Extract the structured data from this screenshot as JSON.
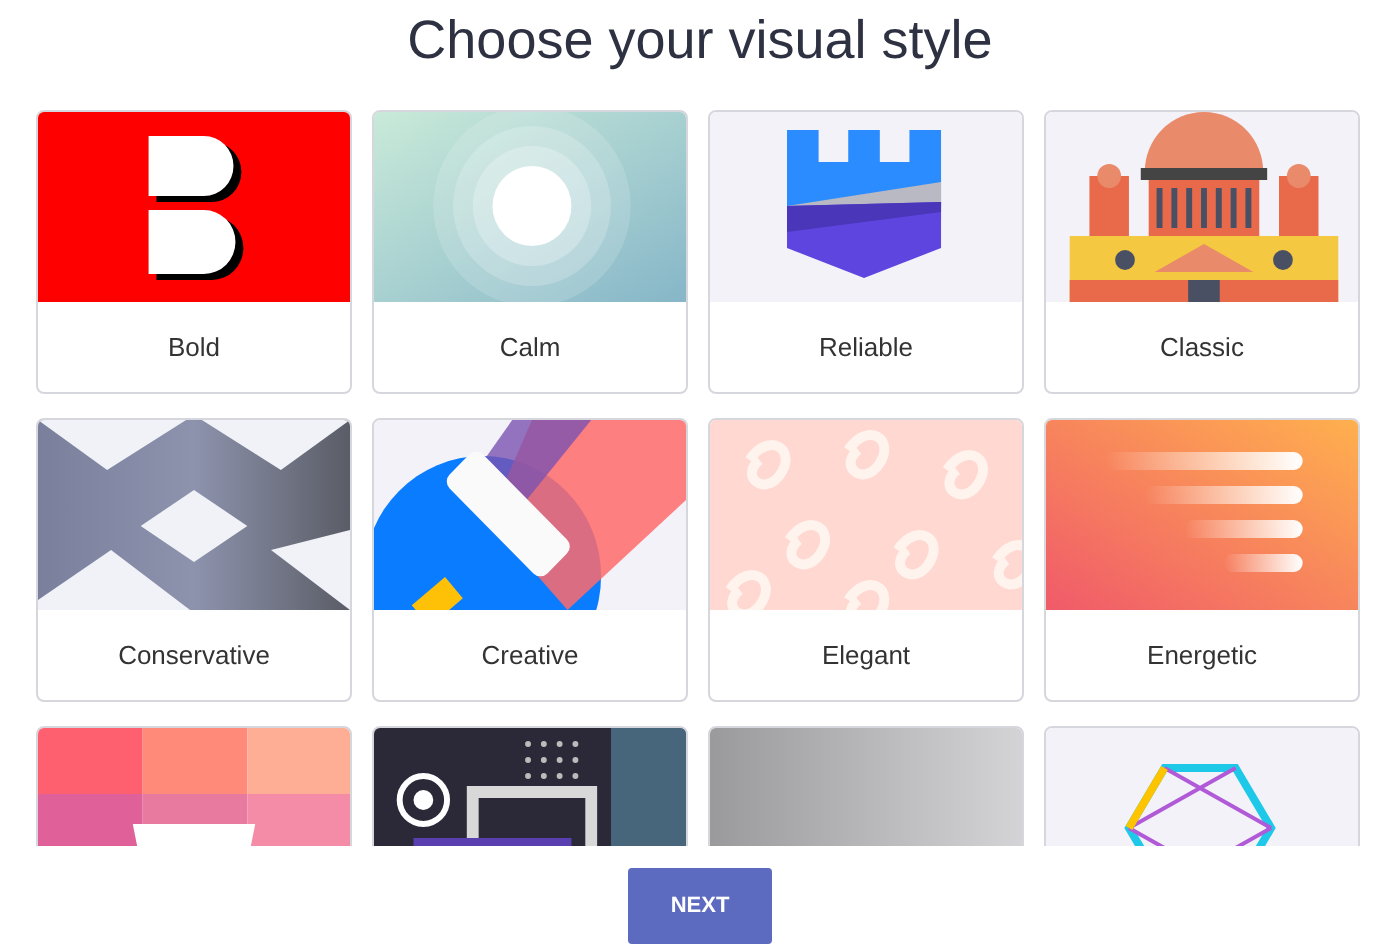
{
  "title": "Choose your visual style",
  "styles": [
    {
      "kind": "bold",
      "label": "Bold"
    },
    {
      "kind": "calm",
      "label": "Calm"
    },
    {
      "kind": "reliable",
      "label": "Reliable"
    },
    {
      "kind": "classic",
      "label": "Classic"
    },
    {
      "kind": "conservative",
      "label": "Conservative"
    },
    {
      "kind": "creative",
      "label": "Creative"
    },
    {
      "kind": "elegant",
      "label": "Elegant"
    },
    {
      "kind": "energetic",
      "label": "Energetic"
    },
    {
      "kind": "tiles"
    },
    {
      "kind": "dark"
    },
    {
      "kind": "metal"
    },
    {
      "kind": "hexagon"
    }
  ],
  "button": "NEXT"
}
